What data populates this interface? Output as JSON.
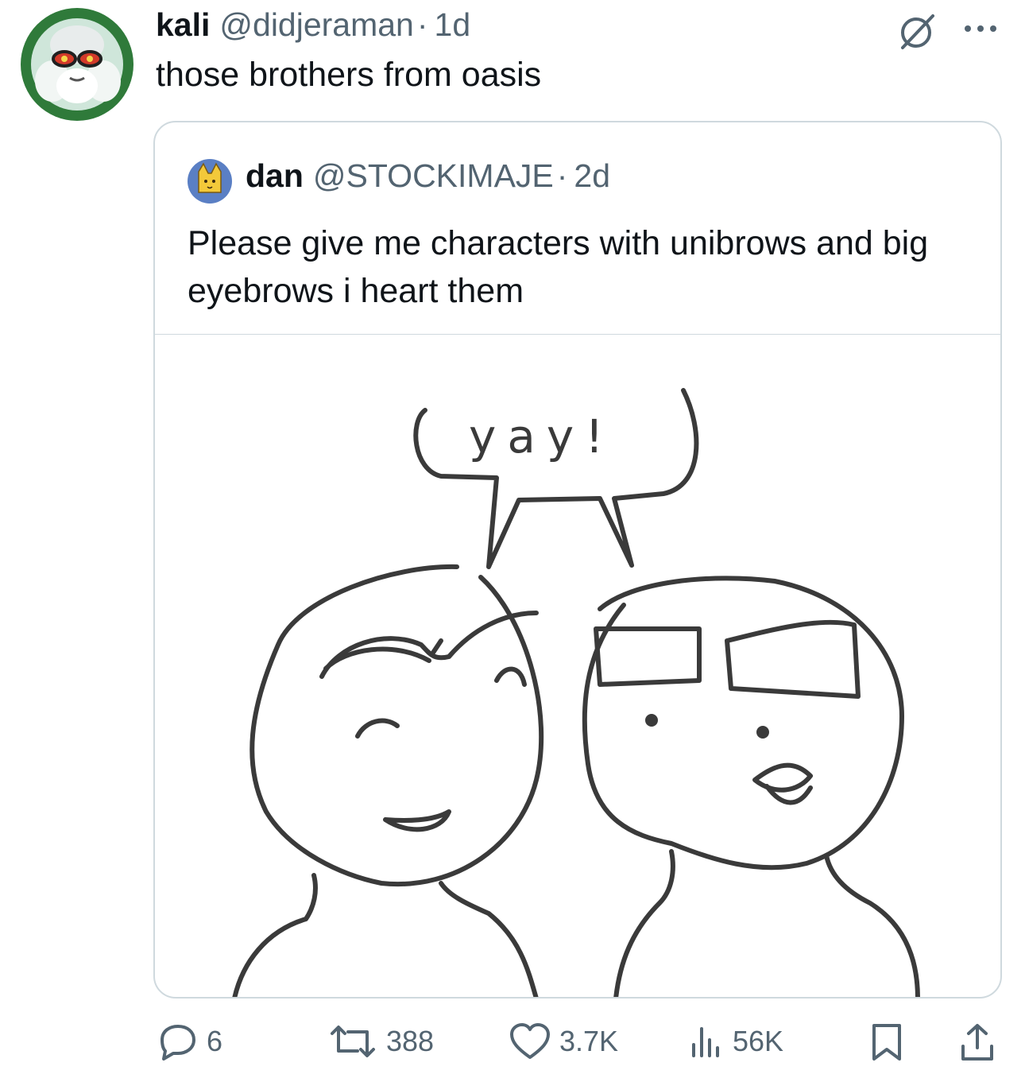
{
  "tweet": {
    "display_name": "kali",
    "handle": "@didjeraman",
    "separator": "·",
    "time": "1d",
    "text": "those brothers from oasis"
  },
  "quoted": {
    "display_name": "dan",
    "handle": "@STOCKIMAJE",
    "separator": "·",
    "time": "2d",
    "text": "Please give me characters with unibrows and big eyebrows i heart them",
    "image_caption": "yay!"
  },
  "actions": {
    "replies": "6",
    "reposts": "388",
    "likes": "3.7K",
    "views": "56K"
  },
  "colors": {
    "text": "#0f1419",
    "muted": "#536471",
    "border": "#cfd9de"
  },
  "icons": [
    "grok-icon",
    "more-icon",
    "reply-icon",
    "repost-icon",
    "like-icon",
    "views-icon",
    "bookmark-icon",
    "share-icon"
  ]
}
